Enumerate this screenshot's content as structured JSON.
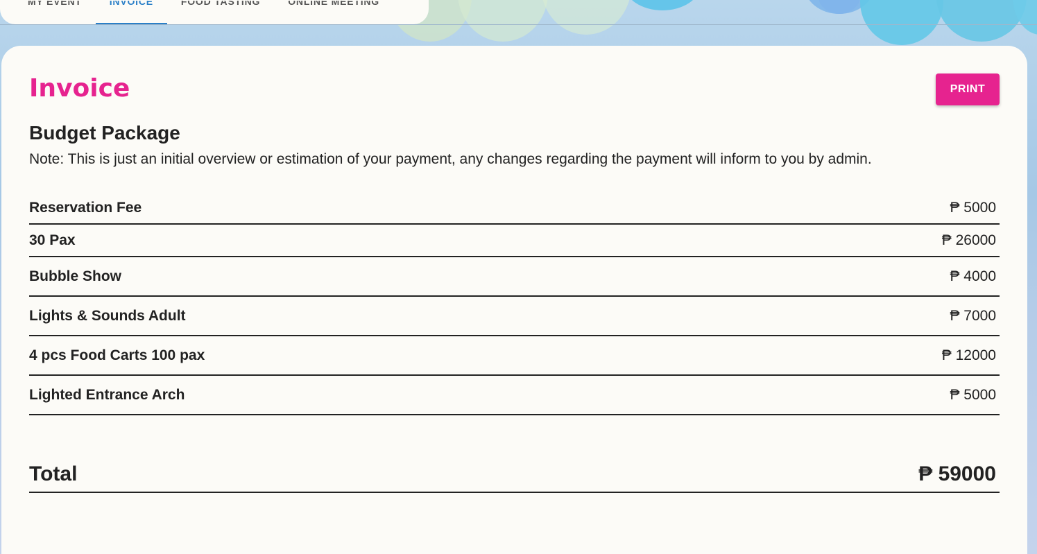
{
  "tabs": [
    {
      "label": "My Event",
      "active": false
    },
    {
      "label": "Invoice",
      "active": true
    },
    {
      "label": "Food Tasting",
      "active": false
    },
    {
      "label": "Online Meeting",
      "active": false
    }
  ],
  "invoice": {
    "title": "Invoice",
    "print_label": "PRINT",
    "package_name": "Budget Package",
    "note": "Note: This is just an initial overview or estimation of your payment, any changes regarding the payment will inform to you by admin.",
    "items": [
      {
        "name": "Reservation Fee",
        "amount": "₱ 5000"
      },
      {
        "name": "30 Pax",
        "amount": "₱ 26000"
      },
      {
        "name": "Bubble Show",
        "amount": "₱ 4000"
      },
      {
        "name": "Lights & Sounds Adult",
        "amount": "₱ 7000"
      },
      {
        "name": "4 pcs Food Carts 100 pax",
        "amount": "₱ 12000"
      },
      {
        "name": "Lighted Entrance Arch",
        "amount": "₱ 5000"
      }
    ],
    "total_label": "Total",
    "total_amount": "₱ 59000"
  },
  "colors": {
    "accent": "#e6238f",
    "tab_active": "#2a7fc7",
    "text": "#222222",
    "card_bg": "#fcfbf7"
  }
}
